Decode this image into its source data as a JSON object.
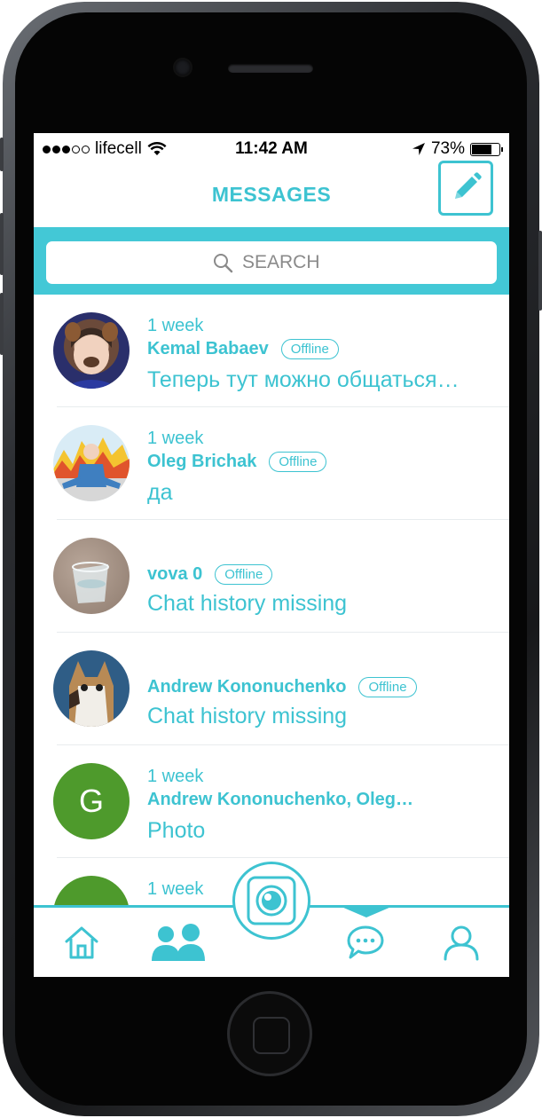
{
  "status_bar": {
    "carrier": "lifecell",
    "time": "11:42 AM",
    "battery": "73%",
    "battery_level": 0.73
  },
  "header": {
    "title": "MESSAGES",
    "compose_icon": "pencil-icon"
  },
  "search": {
    "placeholder": "SEARCH",
    "icon": "search-icon"
  },
  "conversations": [
    {
      "time": "1 week",
      "name": "Kemal Babaev",
      "status": "Offline",
      "last_message": "Теперь тут можно общаться…"
    },
    {
      "time": "1 week",
      "name": "Oleg Brichak",
      "status": "Offline",
      "last_message": "да"
    },
    {
      "time": "",
      "name": "vova 0",
      "status": "Offline",
      "last_message": "Chat history missing"
    },
    {
      "time": "",
      "name": "Andrew Kononuchenko",
      "status": "Offline",
      "last_message": "Chat history missing"
    },
    {
      "time": "1 week",
      "name": "Andrew Kononuchenko, Oleg…",
      "status": "",
      "last_message": "Photo",
      "avatar_letter": "G"
    },
    {
      "time": "1 week",
      "name": "",
      "status": "",
      "last_message": ""
    }
  ],
  "tab_bar": {
    "items": [
      "home-icon",
      "contacts-icon",
      "camera-icon",
      "chat-icon",
      "profile-icon"
    ],
    "active": "chat-icon"
  },
  "colors": {
    "accent": "#3dc3d1",
    "search_band": "#43c8d6",
    "group_avatar": "#4e9a2c"
  }
}
